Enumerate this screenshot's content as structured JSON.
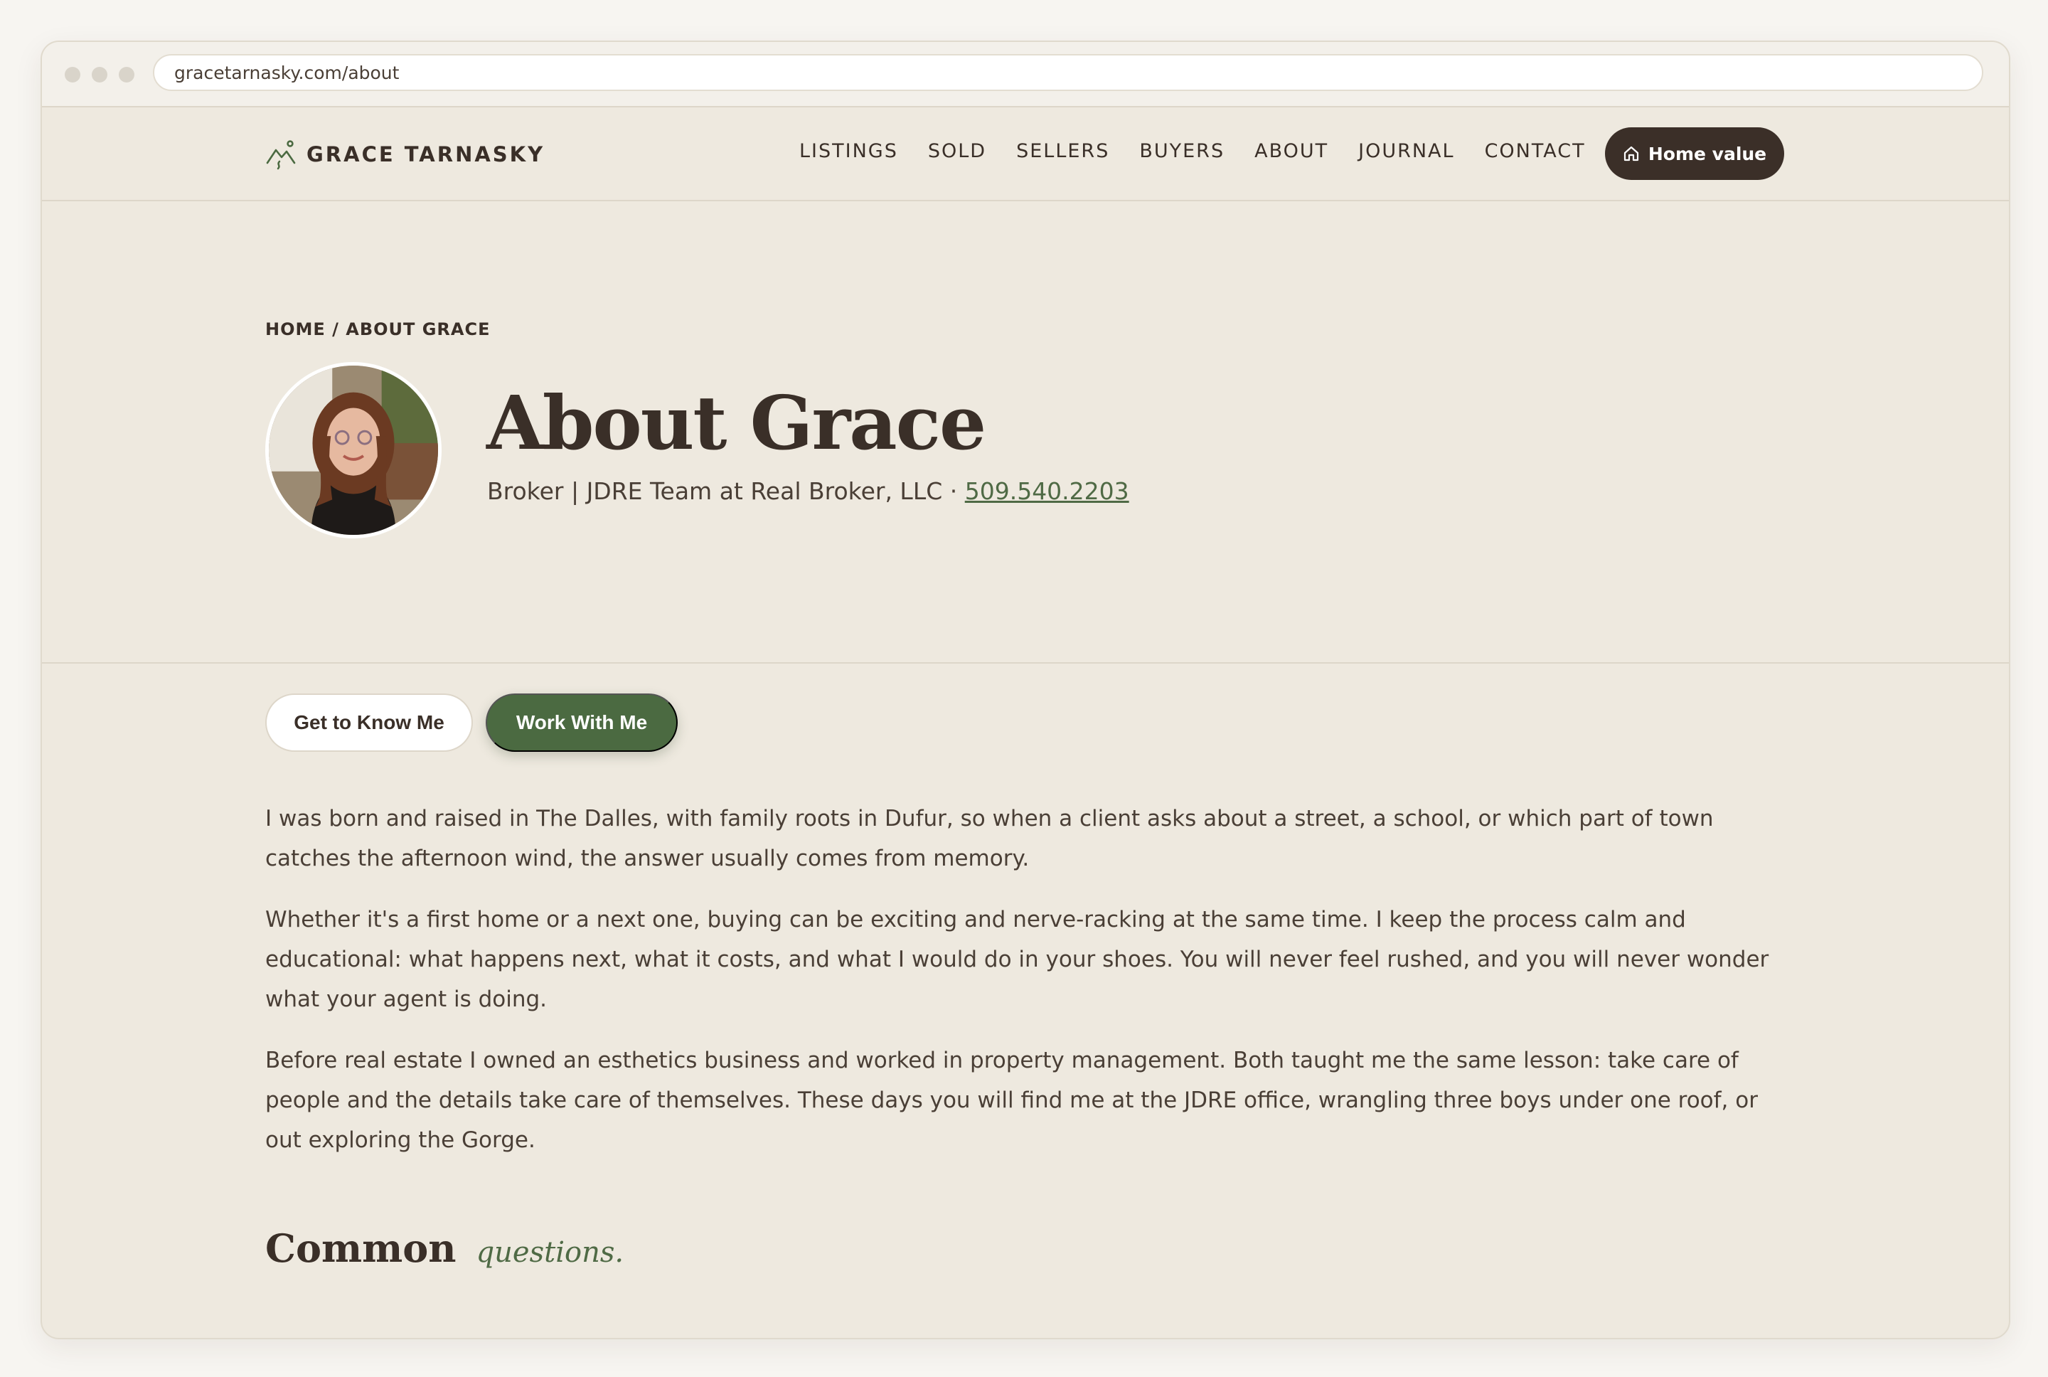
{
  "browser": {
    "url": "gracetarnasky.com/about"
  },
  "brand": {
    "name": "GRACE TARNASKY",
    "logo_icon": "mountain-icon"
  },
  "nav": {
    "links": [
      "LISTINGS",
      "SOLD",
      "SELLERS",
      "BUYERS",
      "ABOUT",
      "JOURNAL",
      "CONTACT"
    ],
    "cta_label": "Home value",
    "cta_icon": "home-icon"
  },
  "hero": {
    "breadcrumb": "HOME / ABOUT GRACE",
    "title": "About Grace",
    "subtitle": "Broker | JDRE Team at Real Broker, LLC · ",
    "phone": "509.540.2203"
  },
  "tabs": {
    "tab1": "Get to Know Me",
    "tab2": "Work With Me"
  },
  "body": {
    "paragraphs": [
      "I was born and raised in The Dalles, with family roots in Dufur, so when a client asks about a street, a school, or which part of town catches the afternoon wind, the answer usually comes from memory.",
      "Whether it's a first home or a next one, buying can be exciting and nerve-racking at the same time. I keep the process calm and educational: what happens next, what it costs, and what I would do in your shoes. You will never feel rushed, and you will never wonder what your agent is doing.",
      "Before real estate I owned an esthetics business and worked in property management. Both taught me the same lesson: take care of people and the details take care of themselves. These days you will find me at the JDRE office, wrangling three boys under one roof, or out exploring the Gorge."
    ]
  },
  "faq": {
    "heading_main": "Common",
    "heading_script": "questions."
  },
  "colors": {
    "accent_green": "#4b6a41",
    "dark": "#3b2f28",
    "background": "#eee9df"
  }
}
